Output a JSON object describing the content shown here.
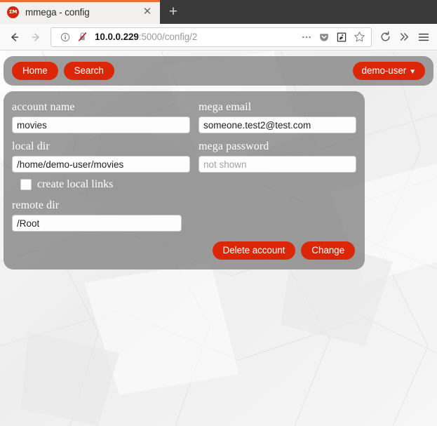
{
  "browser": {
    "tab": {
      "title": "mmega - config",
      "favicon_icon": "mmega-logo-icon",
      "favicon_text": "ΣM",
      "close_icon": "close-icon"
    },
    "newtab_label": "+",
    "toolbar": {
      "back_icon": "back-arrow-icon",
      "forward_icon": "forward-arrow-icon",
      "info_icon": "page-info-icon",
      "insecure_icon": "insecure-connection-icon",
      "url_host": "10.0.0.229",
      "url_path": ":5000/config/2",
      "url_full": "10.0.0.229:5000/config/2",
      "more_icon": "page-actions-ellipsis-icon",
      "pocket_icon": "pocket-icon",
      "reader_icon": "reader-view-icon",
      "bookmark_icon": "star-bookmark-icon",
      "reload_icon": "reload-icon",
      "overflow_icon": "chevron-double-right-icon",
      "menu_icon": "hamburger-menu-icon"
    }
  },
  "navbar": {
    "home_label": "Home",
    "search_label": "Search",
    "user_label": "demo-user",
    "user_caret_icon": "chevron-down-icon"
  },
  "form": {
    "fields": {
      "account_name": {
        "label": "account name",
        "value": "movies",
        "placeholder": ""
      },
      "mega_email": {
        "label": "mega email",
        "value": "someone.test2@test.com",
        "placeholder": ""
      },
      "local_dir": {
        "label": "local dir",
        "value": "/home/demo-user/movies",
        "placeholder": ""
      },
      "mega_password": {
        "label": "mega password",
        "value": "",
        "placeholder": "not shown"
      },
      "remote_dir": {
        "label": "remote dir",
        "value": "/Root",
        "placeholder": ""
      }
    },
    "checkbox": {
      "label": "create local links",
      "checked": false
    },
    "buttons": {
      "delete_label": "Delete account",
      "change_label": "Change"
    }
  },
  "colors": {
    "accent_red": "#dc2608",
    "panel_gray": "#787878",
    "tab_accent_orange": "#e8703a"
  }
}
